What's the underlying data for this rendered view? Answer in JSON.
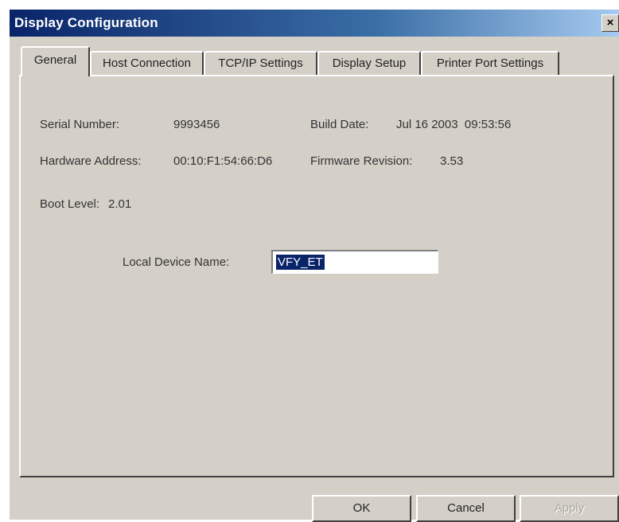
{
  "window": {
    "title": "Display Configuration",
    "close_label": "×"
  },
  "tabs": [
    {
      "label": "General",
      "active": true
    },
    {
      "label": "Host Connection",
      "active": false
    },
    {
      "label": "TCP/IP Settings",
      "active": false
    },
    {
      "label": "Display Setup",
      "active": false
    },
    {
      "label": "Printer Port Settings",
      "active": false
    }
  ],
  "general": {
    "serial_number_label": "Serial Number:",
    "serial_number_value": "9993456",
    "build_date_label": "Build Date:",
    "build_date_value": "Jul 16 2003  09:53:56",
    "hardware_address_label": "Hardware Address:",
    "hardware_address_value": "00:10:F1:54:66:D6",
    "firmware_revision_label": "Firmware Revision:",
    "firmware_revision_value": "3.53",
    "boot_level_label": "Boot Level:",
    "boot_level_value": "2.01",
    "local_device_name_label": "Local Device Name:",
    "local_device_name_value": "VFY_ET"
  },
  "buttons": {
    "ok_label": "OK",
    "cancel_label": "Cancel",
    "apply_label": "Apply"
  },
  "colors": {
    "title_bar": "#0a246a",
    "dialog_face": "#d4d0c8",
    "selection": "#0a246a"
  }
}
